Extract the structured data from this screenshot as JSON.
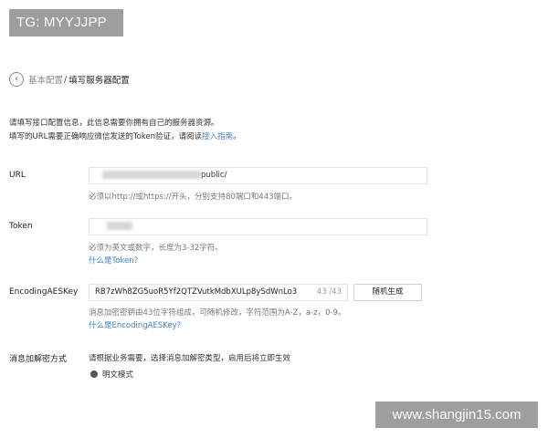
{
  "watermark_top": "TG: MYYJJPP",
  "watermark_bottom": "www.shangjin15.com",
  "breadcrumb": {
    "back_glyph": "‹",
    "parent": "基本配置",
    "separator": "/",
    "current": "填写服务器配置"
  },
  "intro": {
    "line1": "请填写接口配置信息，此信息需要你拥有自己的服务器资源。",
    "line2_prefix": "填写的URL需要正确响应微信发送的Token验证，请阅读",
    "line2_link": "接入指南",
    "line2_suffix": "。"
  },
  "url_field": {
    "label": "URL",
    "value_visible": "public/",
    "hint": "必须以http://或https://开头，分别支持80端口和443端口。"
  },
  "token_field": {
    "label": "Token",
    "hint": "必须为英文或数字，长度为3-32字符。",
    "help_link": "什么是Token？"
  },
  "aes_field": {
    "label": "EncodingAESKey",
    "value": "RB7zWh8ZG5uoR5Yf2QTZVutkMdbXULp8ySdWnLo3",
    "count": "43 /43",
    "random_button": "随机生成",
    "hint": "消息加密密钥由43位字符组成，可随机修改，字符范围为A-Z，a-z，0-9。",
    "help_link": "什么是EncodingAESKey？"
  },
  "encryption": {
    "label": "消息加解密方式",
    "description": "请根据业务需要，选择消息加解密类型，启用后将立即生效",
    "selected_option": "明文模式"
  }
}
